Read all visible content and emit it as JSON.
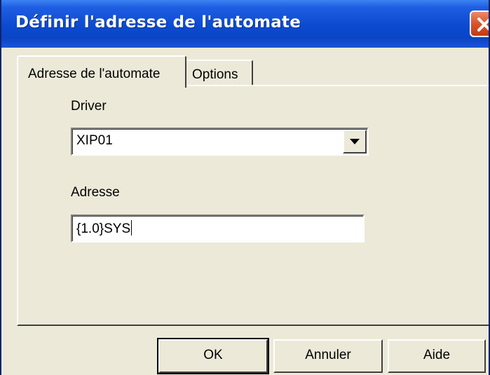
{
  "window": {
    "title": "Définir l'adresse de l'automate"
  },
  "tabs": [
    {
      "label": "Adresse de l'automate",
      "active": true
    },
    {
      "label": "Options",
      "active": false
    }
  ],
  "driver": {
    "label": "Driver",
    "value": "XIP01"
  },
  "address": {
    "label": "Adresse",
    "value": "{1.0}SYS"
  },
  "buttons": {
    "ok": "OK",
    "cancel": "Annuler",
    "help": "Aide"
  },
  "icons": {
    "close": "close-icon",
    "dropdown": "chevron-down-icon"
  },
  "colors": {
    "titlebar": "#0b4ad0",
    "close_button": "#d9542a",
    "dialog_bg": "#ece9d8"
  }
}
